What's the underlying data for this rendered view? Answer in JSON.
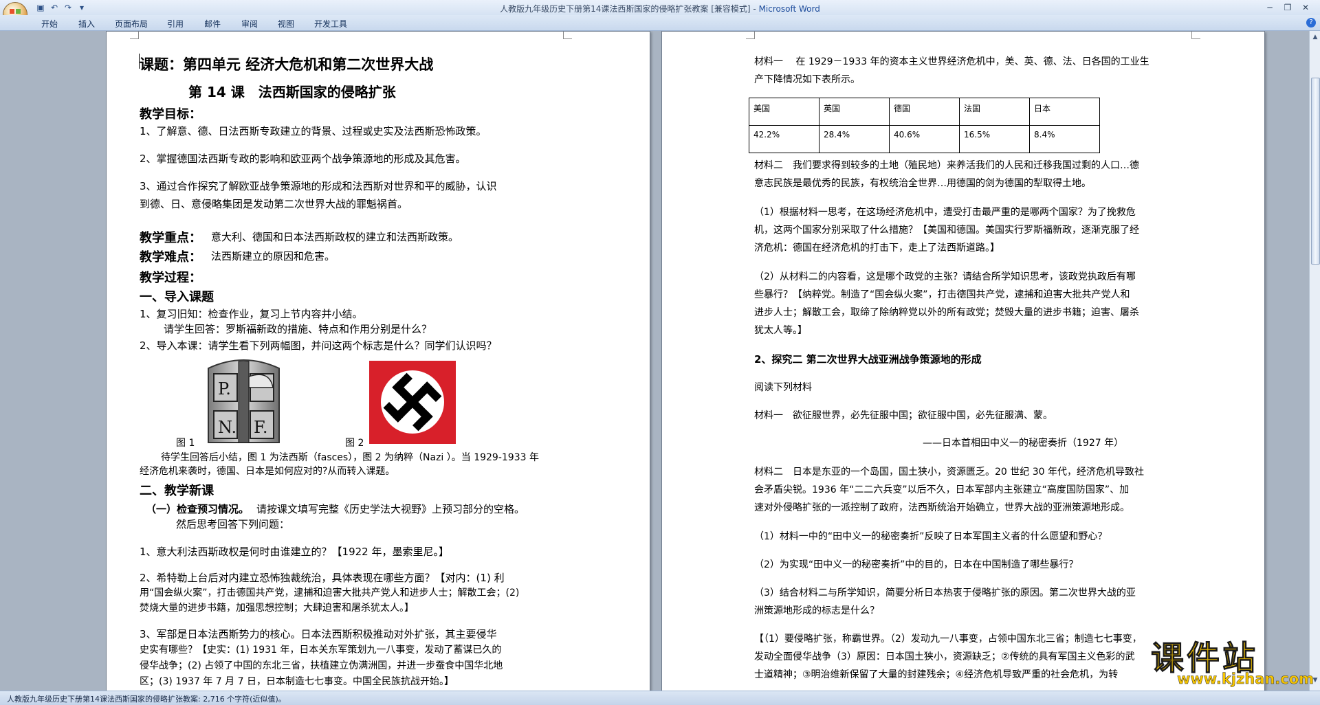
{
  "window": {
    "title": "人教版九年级历史下册第14课法西斯国家的侵略扩张教案 [兼容模式] - ",
    "app_name": "Microsoft Word",
    "quick_access": [
      "save-icon",
      "undo-icon",
      "redo-icon",
      "customize-icon"
    ]
  },
  "ribbon_tabs": [
    "开始",
    "插入",
    "页面布局",
    "引用",
    "邮件",
    "审阅",
    "视图",
    "开发工具"
  ],
  "left_page": {
    "lines": [
      "课题：第四单元 经济大危机和第二次世界大战",
      "第 14 课　法西斯国家的侵略扩张",
      "教学目标：",
      "1、了解意、德、日法西斯专政建立的背景、过程或史实及法西斯恐怖政策。",
      "2、掌握德国法西斯专政的影响和欧亚两个战争策源地的形成及其危害。",
      "3、通过合作探究了解欧亚战争策源地的形成和法西斯对世界和平的威胁，认识",
      "到德、日、意侵略集团是发动第二次世界大战的罪魁祸首。",
      "教学重点：",
      "意大利、德国和日本法西斯政权的建立和法西斯政策。",
      "教学难点：",
      "法西斯建立的原因和危害。",
      "教学过程：",
      "一、导入课题",
      "1、复习旧知：检查作业，复习上节内容并小结。",
      "请学生回答：罗斯福新政的措施、特点和作用分别是什么？",
      "2、导入本课：请学生看下列两幅图，并问这两个标志是什么？同学们认识吗？",
      "图 1",
      "图 2",
      "待学生回答后小结，图 1 为法西斯（fasces），图 2 为纳粹（Nazi ）。当 1929-1933 年",
      "经济危机来袭时，德国、日本是如何应对的?从而转入课题。",
      "二、教学新课",
      "（一）检查预习情况。",
      "请按课文填写完整《历史学法大视野》上预习部分的空格。",
      "然后思考回答下列问题：",
      "1、意大利法西斯政权是何时由谁建立的？【1922 年，墨索里尼。】",
      "2、希特勒上台后对内建立恐怖独裁统治，具体表现在哪些方面？【对内：(1) 利",
      "用“国会纵火案”，打击德国共产党，逮捕和迫害大批共产党人和进步人士；解散工会；(2)",
      "焚烧大量的进步书籍，加强思想控制；大肆迫害和屠杀犹太人。】",
      "3、军部是日本法西斯势力的核心。日本法西斯积极推动对外扩张，其主要侵华",
      "史实有哪些？【史实：(1) 1931 年，日本关东军策划九一八事变，发动了蓄谋已久的",
      "侵华战争；(2) 占领了中国的东北三省，扶植建立伪满洲国，并进一步蚕食中国华北地",
      "区；(3) 1937 年 7 月 7 日，日本制造七七事变。中国全民族抗战开始。】"
    ],
    "emblem_letters": [
      "P.",
      "N.",
      "F."
    ]
  },
  "right_page": {
    "lines": [
      "材料一　 在 1929－1933 年的资本主义世界经济危机中，美、英、德、法、日各国的工业生",
      "产下降情况如下表所示。",
      "材料二　我们要求得到较多的土地（殖民地）来养活我们的人民和迁移我国过剩的人口…德",
      "意志民族是最优秀的民族，有权统治全世界…用德国的剑为德国的犁取得土地。",
      "（1）根据材料一思考，在这场经济危机中，遭受打击最严重的是哪两个国家？为了挽救危",
      "机，这两个国家分别采取了什么措施？【美国和德国。美国实行罗斯福新政，逐渐克服了经",
      "济危机：德国在经济危机的打击下，走上了法西斯道路。】",
      "（2）从材料二的内容看，这是哪个政党的主张？请结合所学知识思考，该政党执政后有哪",
      "些暴行？【纳粹党。制造了“国会纵火案”，打击德国共产党，逮捕和迫害大批共产党人和",
      "进步人士；解散工会，取缔了除纳粹党以外的所有政党；焚毁大量的进步书籍；迫害、屠杀",
      "犹太人等。】",
      "2、探究二 第二次世界大战亚洲战争策源地的形成",
      "阅读下列材料",
      "材料一　欲征服世界，必先征服中国；欲征服中国，必先征服满、蒙。",
      "——日本首相田中义一的秘密奏折（1927 年）",
      "材料二　日本是东亚的一个岛国，国土狭小，资源匮乏。20 世纪 30 年代，经济危机导致社",
      "会矛盾尖锐。1936 年“二二六兵变”以后不久，日本军部内主张建立“高度国防国家”、加",
      "速对外侵略扩张的一派控制了政府，法西斯统治开始确立，世界大战的亚洲策源地形成。",
      "（1）材料一中的“田中义一的秘密奏折”反映了日本军国主义者的什么愿望和野心？",
      "（2）为实现“田中义一的秘密奏折”中的目的，日本在中国制造了哪些暴行？",
      "（3）结合材料二与所学知识，简要分析日本热衷于侵略扩张的原因。第二次世界大战的亚",
      "洲策源地形成的标志是什么？",
      "【（1）要侵略扩张，称霸世界。（2）发动九一八事变，占领中国东北三省；制造七七事变，",
      "发动全面侵华战争（3）原因：日本国土狭小，资源缺乏；②传统的具有军国主义色彩的武",
      "士道精神；③明治维新保留了大量的封建残余；④经济危机导致严重的社会危机，为转"
    ],
    "table": {
      "headers": [
        "美国",
        "英国",
        "德国",
        "法国",
        "日本"
      ],
      "values": [
        "42.2%",
        "28.4%",
        "40.6%",
        "16.5%",
        "8.4%"
      ]
    }
  },
  "status_bar": "人教版九年级历史下册第14课法西斯国家的侵略扩张教案: 2,716 个字符(近似值)。",
  "watermark": {
    "text": "课件站",
    "url": "www.kjzhan.com"
  },
  "colors": {
    "ribbon": "#d6e3f3",
    "canvas": "#a9b4c2",
    "flag_red": "#d8202a",
    "watermark_yellow": "#f5c400"
  }
}
